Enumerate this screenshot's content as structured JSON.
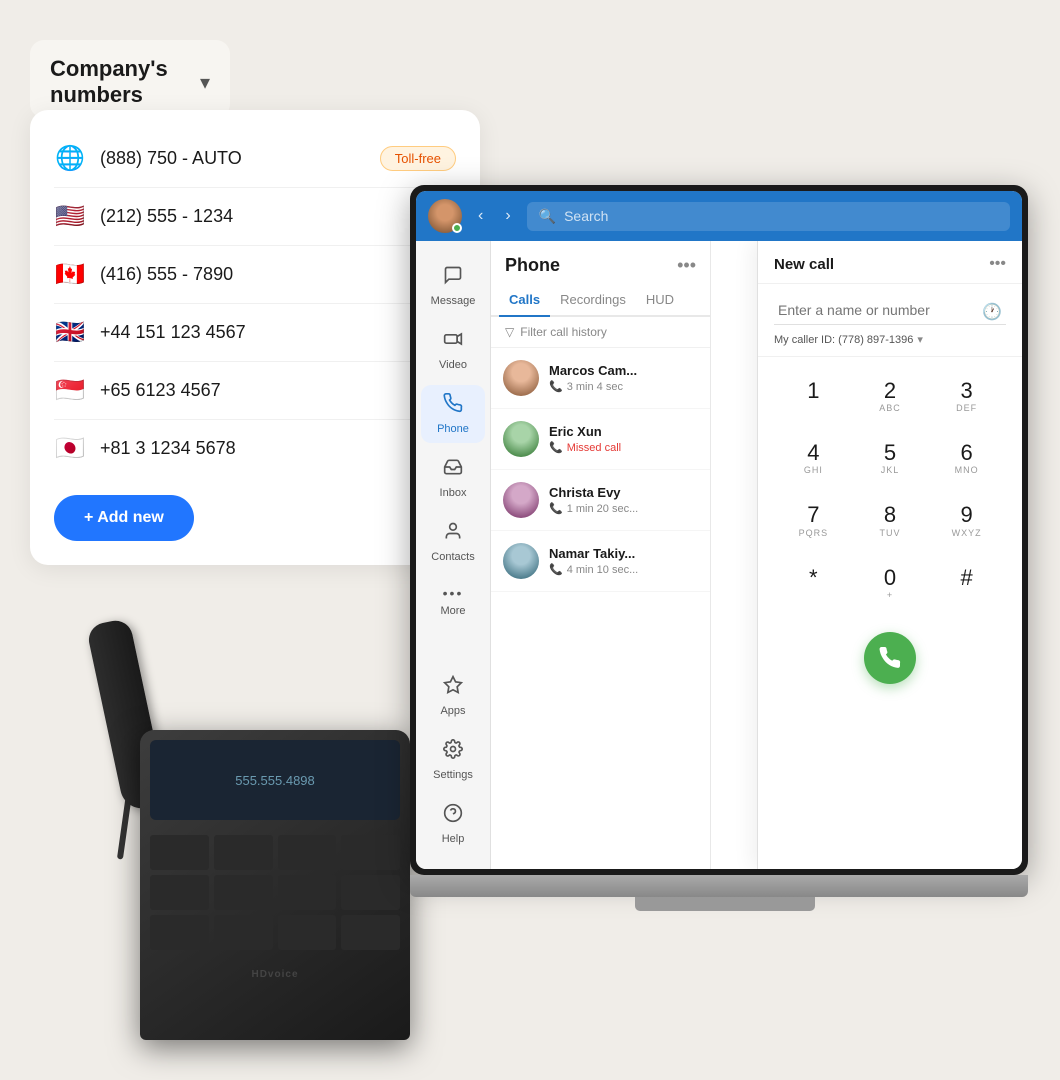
{
  "page": {
    "background_color": "#f0ede8"
  },
  "dropdown": {
    "title": "Company's numbers",
    "chevron": "▾"
  },
  "numbers": [
    {
      "flag": "🌐",
      "number": "(888) 750 - AUTO",
      "badge": "Toll-free",
      "type": "globe"
    },
    {
      "flag": "🇺🇸",
      "number": "(212) 555 - 1234",
      "badge": "",
      "type": "flag"
    },
    {
      "flag": "🇨🇦",
      "number": "(416) 555 - 7890",
      "badge": "",
      "type": "flag"
    },
    {
      "flag": "🇬🇧",
      "number": "+44 151 123 4567",
      "badge": "",
      "type": "flag"
    },
    {
      "flag": "🇸🇬",
      "number": "+65 6123 4567",
      "badge": "",
      "type": "flag"
    },
    {
      "flag": "🇯🇵",
      "number": "+81 3 1234 5678",
      "badge": "",
      "type": "flag"
    }
  ],
  "add_new_label": "+ Add new",
  "app": {
    "header": {
      "search_placeholder": "Search"
    },
    "sidebar": [
      {
        "id": "message",
        "icon": "💬",
        "label": "Message"
      },
      {
        "id": "video",
        "icon": "📹",
        "label": "Video"
      },
      {
        "id": "phone",
        "icon": "📞",
        "label": "Phone",
        "active": true
      },
      {
        "id": "inbox",
        "icon": "📥",
        "label": "Inbox"
      },
      {
        "id": "contacts",
        "icon": "👤",
        "label": "Contacts"
      },
      {
        "id": "more",
        "icon": "•••",
        "label": "More"
      },
      {
        "id": "apps",
        "icon": "⚙",
        "label": "Apps"
      },
      {
        "id": "settings",
        "icon": "⚙",
        "label": "Settings"
      },
      {
        "id": "help",
        "icon": "?",
        "label": "Help"
      }
    ],
    "phone_panel": {
      "title": "Phone",
      "tabs": [
        "Calls",
        "Recordings",
        "HUD"
      ],
      "active_tab": "Calls",
      "filter_label": "Filter call history",
      "calls": [
        {
          "name": "Marcos Cam...",
          "detail": "3 min 4 sec",
          "missed": false
        },
        {
          "name": "Eric Xun",
          "detail": "Missed call",
          "missed": true
        },
        {
          "name": "Christa Evy",
          "detail": "1 min 20 sec...",
          "missed": false
        },
        {
          "name": "Namar Takiy...",
          "detail": "4 min 10 sec...",
          "missed": false
        }
      ]
    },
    "dialer": {
      "title": "New call",
      "input_placeholder": "Enter a name or number",
      "caller_id_label": "My caller ID: (778) 897-1396",
      "keys": [
        {
          "num": "1",
          "letters": ""
        },
        {
          "num": "2",
          "letters": "ABC"
        },
        {
          "num": "3",
          "letters": "DEF"
        },
        {
          "num": "4",
          "letters": "GHI"
        },
        {
          "num": "5",
          "letters": "JKL"
        },
        {
          "num": "6",
          "letters": "MNO"
        },
        {
          "num": "7",
          "letters": "PQRS"
        },
        {
          "num": "8",
          "letters": "TUV"
        },
        {
          "num": "9",
          "letters": "WXYZ"
        },
        {
          "num": "*",
          "letters": ""
        },
        {
          "num": "0",
          "letters": "+"
        },
        {
          "num": "#",
          "letters": ""
        }
      ],
      "call_icon": "📞"
    }
  },
  "phone_device": {
    "number": "555.555.4898"
  }
}
